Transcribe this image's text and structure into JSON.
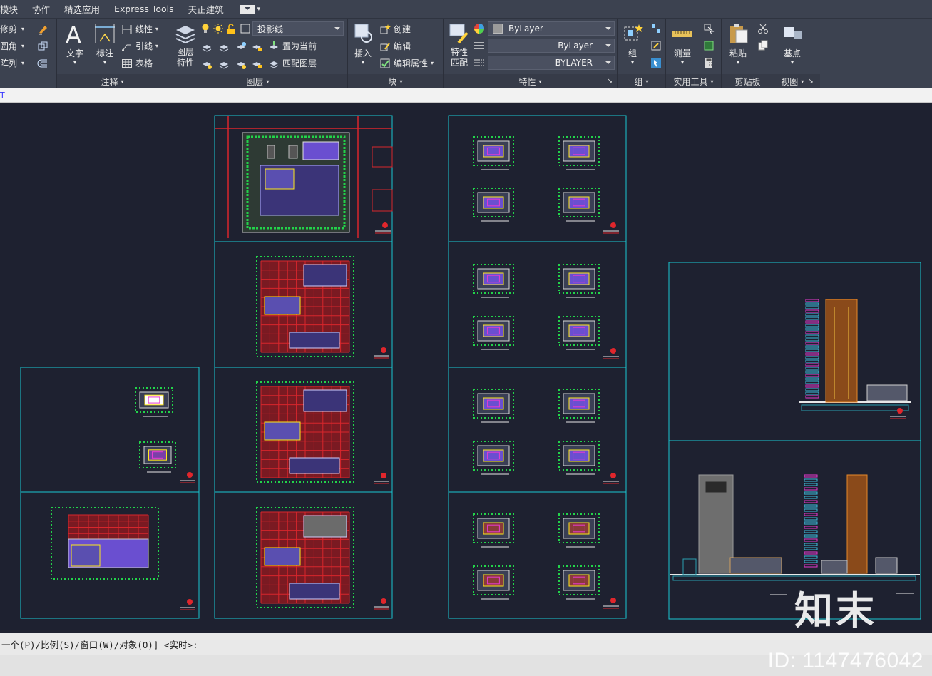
{
  "menu": {
    "items": [
      "模块",
      "协作",
      "精选应用",
      "Express Tools",
      "天正建筑"
    ]
  },
  "ribbon": {
    "modify": {
      "items": [
        "修剪",
        "圆角",
        "阵列"
      ]
    },
    "annotation": {
      "title": "注释",
      "text_label": "文字",
      "dimension_label": "标注",
      "linear_label": "线性",
      "leader_label": "引线",
      "table_label": "表格"
    },
    "layers": {
      "title": "图层",
      "properties_label": "图层\n特性",
      "current_layer": "投影线",
      "set_current_label": "置为当前",
      "match_layer_label": "匹配图层"
    },
    "block": {
      "title": "块",
      "insert_label": "插入",
      "create_label": "创建",
      "edit_label": "编辑",
      "edit_attr_label": "编辑属性"
    },
    "properties": {
      "title": "特性",
      "match_label": "特性\n匹配",
      "color_value": "ByLayer",
      "linetype_value": "ByLayer",
      "lineweight_value": "BYLAYER"
    },
    "group": {
      "title": "组",
      "group_label": "组"
    },
    "utilities": {
      "title": "实用工具",
      "measure_label": "测量"
    },
    "clipboard": {
      "title": "剪贴板",
      "paste_label": "粘贴"
    },
    "view": {
      "title": "视图",
      "base_label": "基点"
    }
  },
  "tabstrip": {
    "marker": "T"
  },
  "command_line": {
    "text": "一个(P)/比例(S)/窗口(W)/对象(O)] <实时>:"
  },
  "watermark": {
    "logo_text": "知末",
    "id_text": "ID: 1147476042"
  },
  "colors": {
    "canvas": "#1e2130",
    "frame": "#19c8d2",
    "grid_red": "#d8262c",
    "plan_green": "#22d44a",
    "plan_yellow": "#ffe81a",
    "elev_orange": "#e8892a",
    "elev_magenta": "#e83bd0"
  }
}
